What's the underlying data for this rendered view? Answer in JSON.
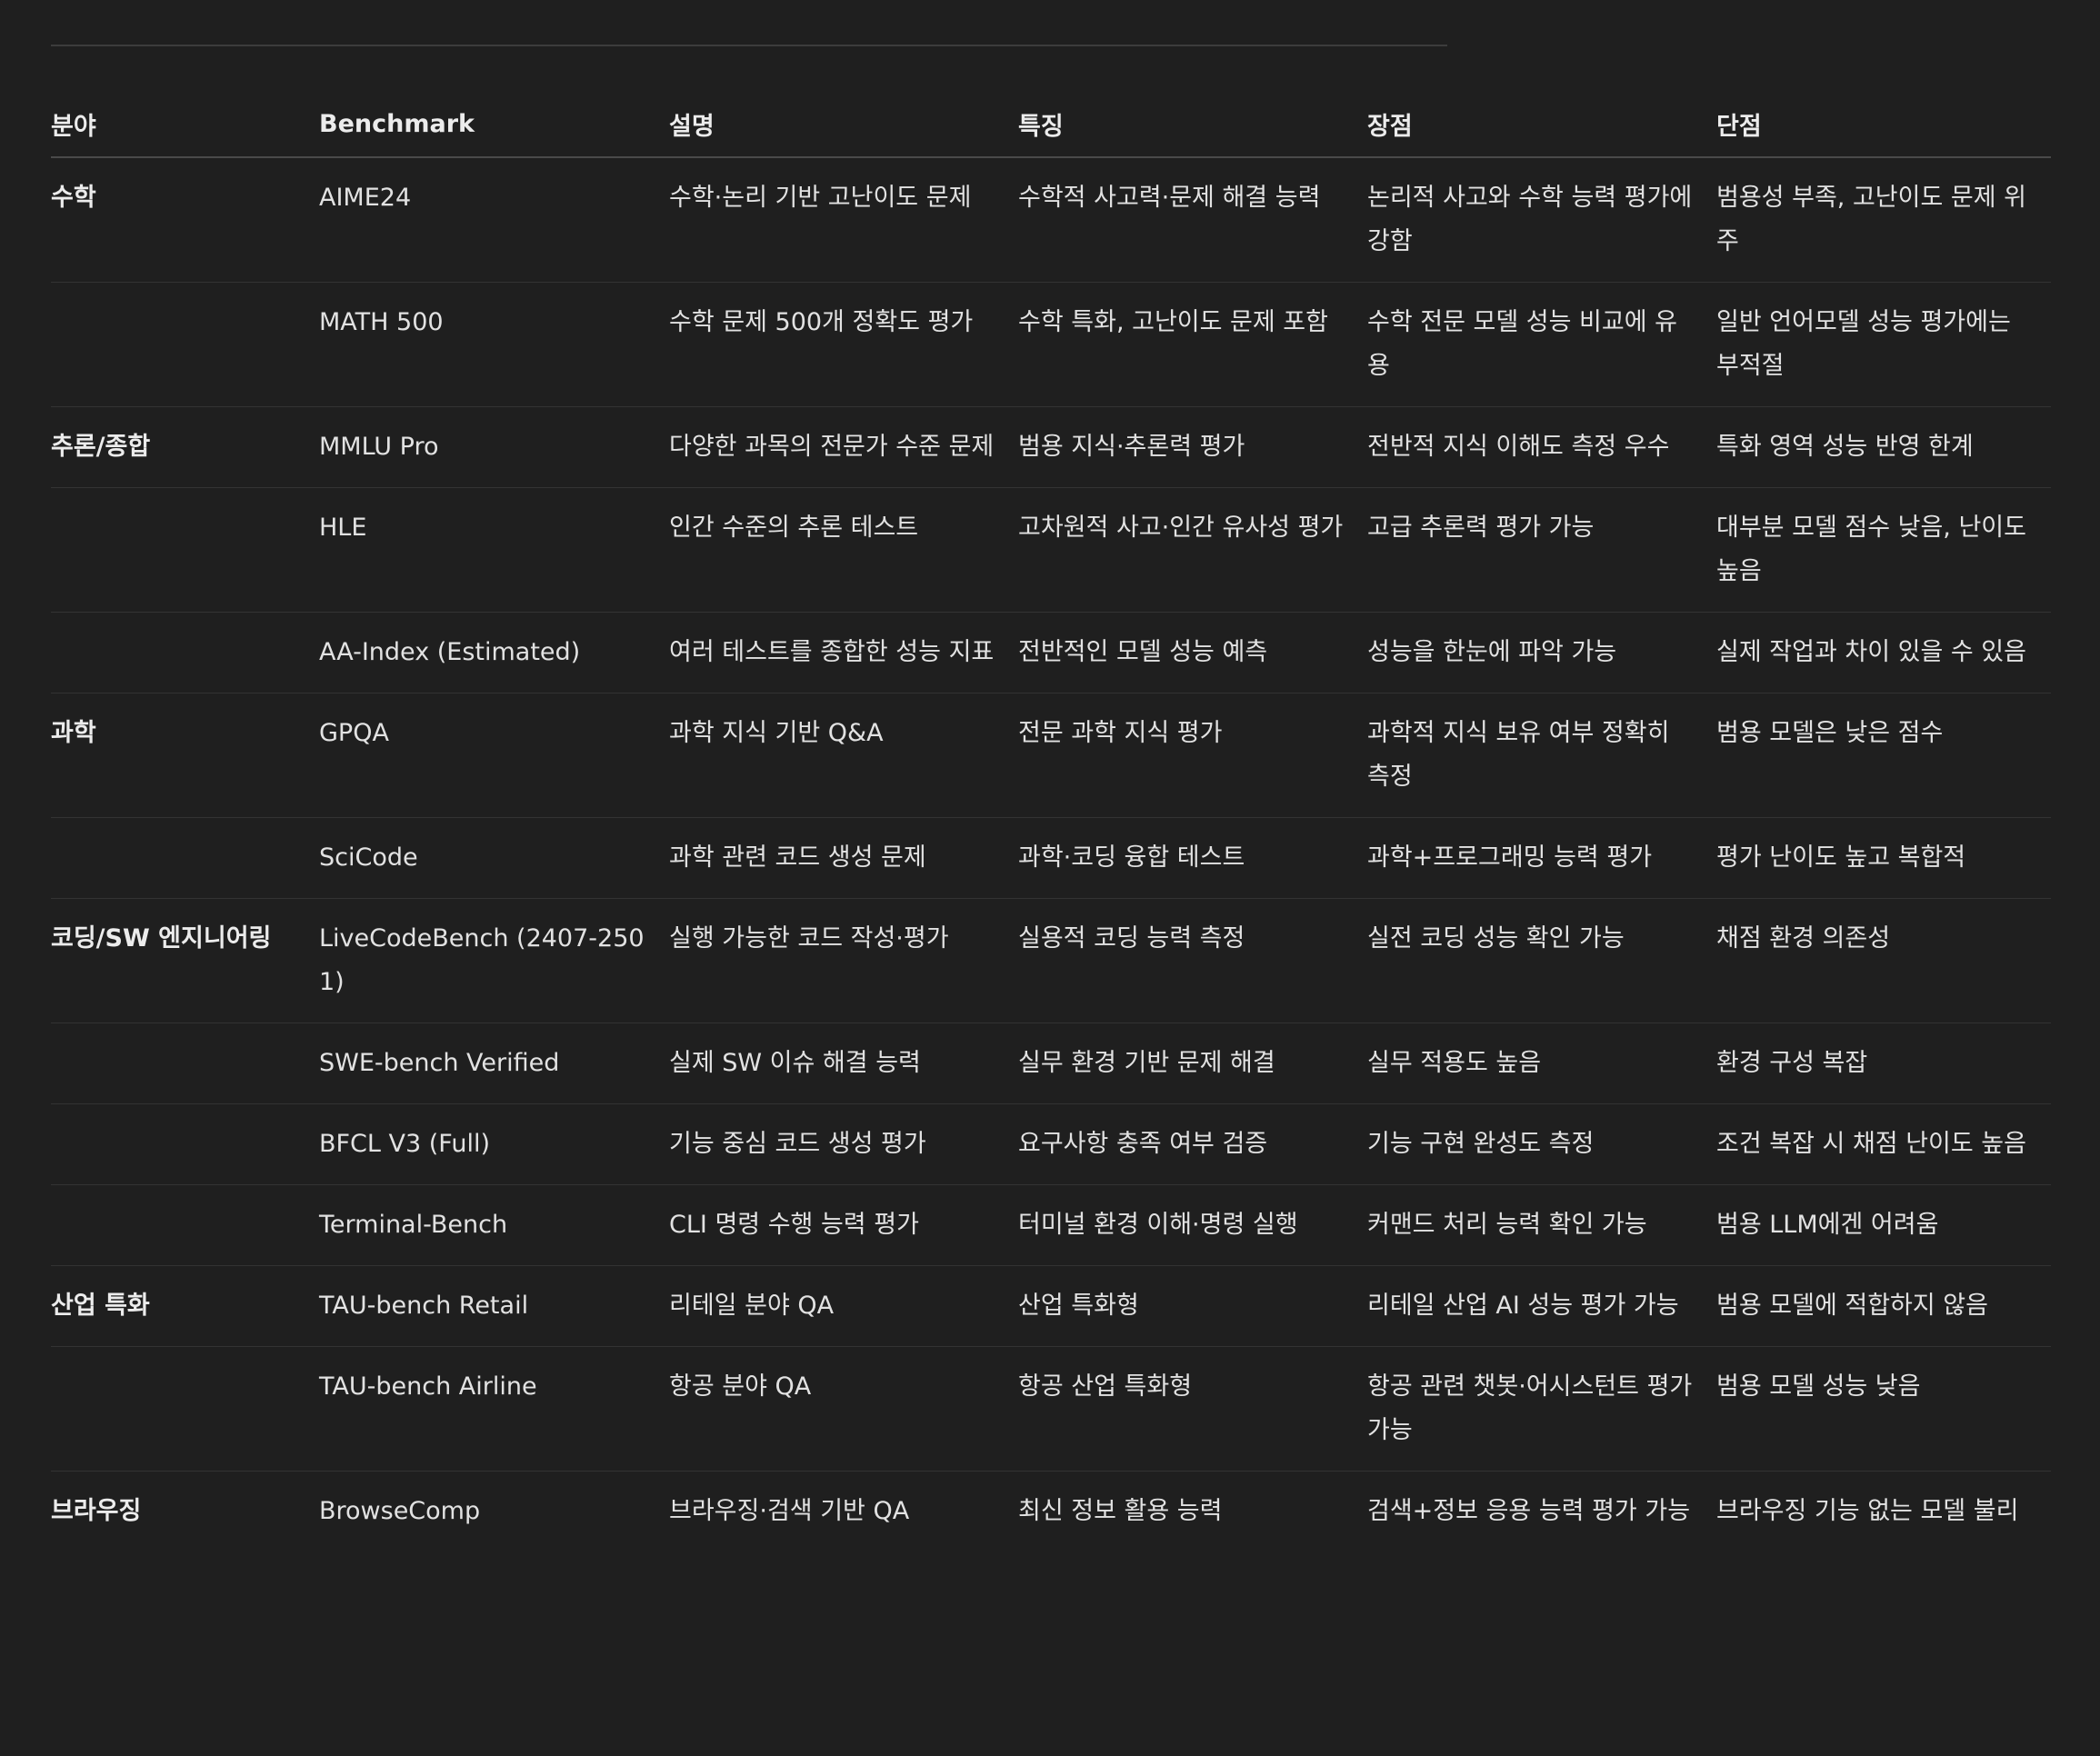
{
  "headers": [
    "분야",
    "Benchmark",
    "설명",
    "특징",
    "장점",
    "단점"
  ],
  "rows": [
    {
      "field": "수학",
      "benchmark": "AIME24",
      "desc": "수학·논리 기반 고난이도 문제",
      "feature": "수학적 사고력·문제 해결 능력",
      "pro": "논리적 사고와 수학 능력 평가에 강함",
      "con": "범용성 부족, 고난이도 문제 위주"
    },
    {
      "field": "",
      "benchmark": "MATH 500",
      "desc": "수학 문제 500개 정확도 평가",
      "feature": "수학 특화, 고난이도 문제 포함",
      "pro": "수학 전문 모델 성능 비교에 유용",
      "con": "일반 언어모델 성능 평가에는 부적절"
    },
    {
      "field": "추론/종합",
      "benchmark": "MMLU Pro",
      "desc": "다양한 과목의 전문가 수준 문제",
      "feature": "범용 지식·추론력 평가",
      "pro": "전반적 지식 이해도 측정 우수",
      "con": "특화 영역 성능 반영 한계"
    },
    {
      "field": "",
      "benchmark": "HLE",
      "desc": "인간 수준의 추론 테스트",
      "feature": "고차원적 사고·인간 유사성 평가",
      "pro": "고급 추론력 평가 가능",
      "con": "대부분 모델 점수 낮음, 난이도 높음"
    },
    {
      "field": "",
      "benchmark": "AA-Index (Estimated)",
      "desc": "여러 테스트를 종합한 성능 지표",
      "feature": "전반적인 모델 성능 예측",
      "pro": "성능을 한눈에 파악 가능",
      "con": "실제 작업과 차이 있을 수 있음"
    },
    {
      "field": "과학",
      "benchmark": "GPQA",
      "desc": "과학 지식 기반 Q&A",
      "feature": "전문 과학 지식 평가",
      "pro": "과학적 지식 보유 여부 정확히 측정",
      "con": "범용 모델은 낮은 점수"
    },
    {
      "field": "",
      "benchmark": "SciCode",
      "desc": "과학 관련 코드 생성 문제",
      "feature": "과학·코딩 융합 테스트",
      "pro": "과학+프로그래밍 능력 평가",
      "con": "평가 난이도 높고 복합적"
    },
    {
      "field": "코딩/SW 엔지니어링",
      "benchmark": "LiveCodeBench (2407-2501)",
      "desc": "실행 가능한 코드 작성·평가",
      "feature": "실용적 코딩 능력 측정",
      "pro": "실전 코딩 성능 확인 가능",
      "con": "채점 환경 의존성"
    },
    {
      "field": "",
      "benchmark": "SWE-bench Verified",
      "desc": "실제 SW 이슈 해결 능력",
      "feature": "실무 환경 기반 문제 해결",
      "pro": "실무 적용도 높음",
      "con": "환경 구성 복잡"
    },
    {
      "field": "",
      "benchmark": "BFCL V3 (Full)",
      "desc": "기능 중심 코드 생성 평가",
      "feature": "요구사항 충족 여부 검증",
      "pro": "기능 구현 완성도 측정",
      "con": "조건 복잡 시 채점 난이도 높음"
    },
    {
      "field": "",
      "benchmark": "Terminal-Bench",
      "desc": "CLI 명령 수행 능력 평가",
      "feature": "터미널 환경 이해·명령 실행",
      "pro": "커맨드 처리 능력 확인 가능",
      "con": "범용 LLM에겐 어려움"
    },
    {
      "field": "산업 특화",
      "benchmark": "TAU-bench Retail",
      "desc": "리테일 분야 QA",
      "feature": "산업 특화형",
      "pro": "리테일 산업 AI 성능 평가 가능",
      "con": "범용 모델에 적합하지 않음"
    },
    {
      "field": "",
      "benchmark": "TAU-bench Airline",
      "desc": "항공 분야 QA",
      "feature": "항공 산업 특화형",
      "pro": "항공 관련 챗봇·어시스턴트 평가 가능",
      "con": "범용 모델 성능 낮음"
    },
    {
      "field": "브라우징",
      "benchmark": "BrowseComp",
      "desc": "브라우징·검색 기반 QA",
      "feature": "최신 정보 활용 능력",
      "pro": "검색+정보 응용 능력 평가 가능",
      "con": "브라우징 기능 없는 모델 불리"
    }
  ]
}
